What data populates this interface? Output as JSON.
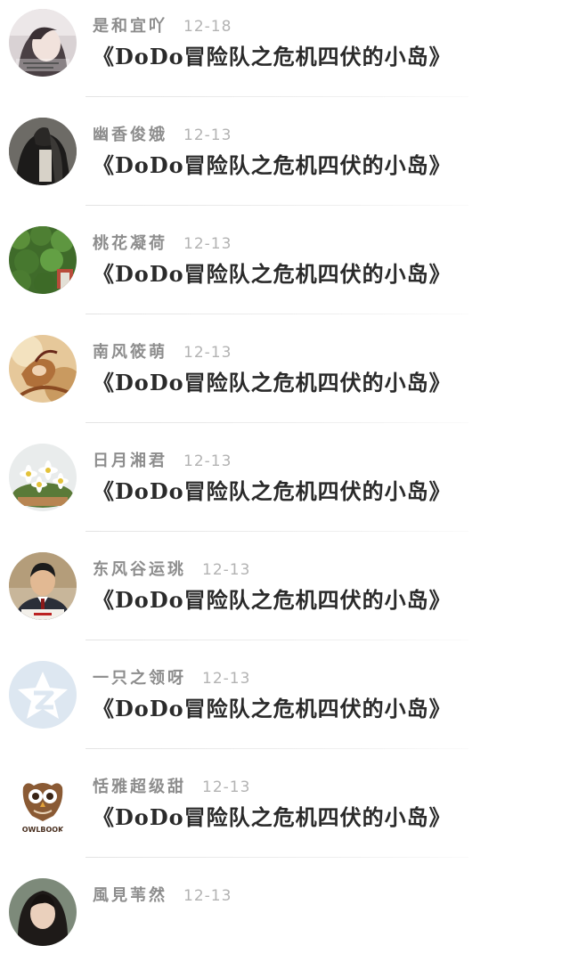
{
  "feed": {
    "items": [
      {
        "username": "是和宜吖",
        "date": "12-18",
        "title": "《DoDo冒险队之危机四伏的小岛》",
        "avatar_icon": "user-photo-girl"
      },
      {
        "username": "幽香俊娥",
        "date": "12-13",
        "title": "《DoDo冒险队之危机四伏的小岛》",
        "avatar_icon": "user-photo-dark"
      },
      {
        "username": "桃花凝荷",
        "date": "12-13",
        "title": "《DoDo冒险队之危机四伏的小岛》",
        "avatar_icon": "user-photo-ivy-wall"
      },
      {
        "username": "南风筱萌",
        "date": "12-13",
        "title": "《DoDo冒险队之危机四伏的小岛》",
        "avatar_icon": "user-photo-illustration"
      },
      {
        "username": "日月湘君",
        "date": "12-13",
        "title": "《DoDo冒险队之危机四伏的小岛》",
        "avatar_icon": "user-photo-flowers"
      },
      {
        "username": "东风谷运珧",
        "date": "12-13",
        "title": "《DoDo冒险队之危机四伏的小岛》",
        "avatar_icon": "user-photo-man"
      },
      {
        "username": "一只之领呀",
        "date": "12-13",
        "title": "《DoDo冒险队之危机四伏的小岛》",
        "avatar_icon": "default-qzone-avatar"
      },
      {
        "username": "恬雅超级甜",
        "date": "12-13",
        "title": "《DoDo冒险队之危机四伏的小岛》",
        "avatar_icon": "owlbook-logo"
      },
      {
        "username": "風見苇然",
        "date": "12-13",
        "title": "",
        "avatar_icon": "user-photo-woman"
      }
    ],
    "owlbook_logo_text": "OWLBOOK",
    "colors": {
      "username": "#8d8d8d",
      "date": "#b3b3b3",
      "title": "#2a2a2a",
      "divider": "#e4e4e4"
    }
  }
}
